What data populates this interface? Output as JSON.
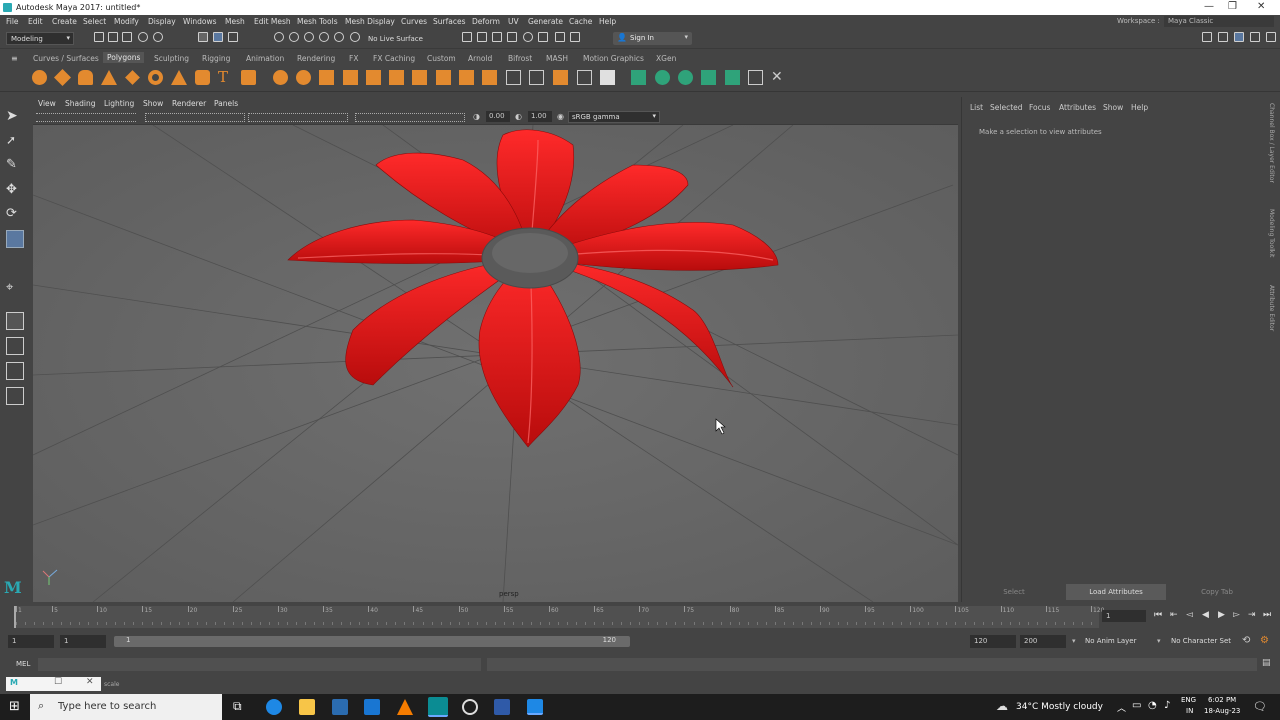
{
  "window": {
    "title": "Autodesk Maya 2017: untitled*"
  },
  "menubar": {
    "items": [
      "File",
      "Edit",
      "Create",
      "Select",
      "Modify",
      "Display",
      "Windows",
      "Mesh",
      "Edit Mesh",
      "Mesh Tools",
      "Mesh Display",
      "Curves",
      "Surfaces",
      "Deform",
      "UV",
      "Generate",
      "Cache",
      "Help"
    ],
    "workspace_label": "Workspace :",
    "workspace_value": "Maya Classic"
  },
  "statusline": {
    "mode": "Modeling",
    "live_surface": "No Live Surface",
    "sign_in": "Sign In"
  },
  "shelf": {
    "tabs": [
      "Curves / Surfaces",
      "Polygons",
      "Sculpting",
      "Rigging",
      "Animation",
      "Rendering",
      "FX",
      "FX Caching",
      "Custom",
      "Arnold",
      "Bifrost",
      "MASH",
      "Motion Graphics",
      "XGen"
    ],
    "active_tab": "Polygons",
    "accent": "#e38a2f"
  },
  "viewport": {
    "menus": [
      "View",
      "Shading",
      "Lighting",
      "Show",
      "Renderer",
      "Panels"
    ],
    "exposure": "0.00",
    "gamma": "1.00",
    "color_space": "sRGB gamma",
    "camera": "persp",
    "object_color": "#e01414",
    "center_color": "#5a5a5a"
  },
  "attribute_editor": {
    "menus": [
      "List",
      "Selected",
      "Focus",
      "Attributes",
      "Show",
      "Help"
    ],
    "message": "Make a selection to view attributes",
    "buttons": [
      "Select",
      "Load Attributes",
      "Copy Tab"
    ],
    "side_tabs": [
      "Channel Box / Layer Editor",
      "Modeling Toolkit",
      "Attribute Editor"
    ]
  },
  "timeline": {
    "ticks": [
      "1",
      "5",
      "10",
      "15",
      "20",
      "25",
      "30",
      "35",
      "40",
      "45",
      "50",
      "55",
      "60",
      "65",
      "70",
      "75",
      "80",
      "85",
      "90",
      "95",
      "100",
      "105",
      "110",
      "115",
      "120"
    ],
    "current_frame": "1"
  },
  "range": {
    "start": "1",
    "playback_start": "1",
    "slider_start": "1",
    "slider_end": "120",
    "playback_end": "120",
    "end": "200",
    "anim_layer": "No Anim Layer",
    "character_set": "No Character Set"
  },
  "command_line": {
    "language": "MEL"
  },
  "help_line": {
    "text": "scale"
  },
  "taskbar": {
    "search_placeholder": "Type here to search",
    "weather": "34°C  Mostly cloudy",
    "lang": "ENG",
    "region": "IN",
    "time": "6:02 PM",
    "date": "18-Aug-23"
  }
}
